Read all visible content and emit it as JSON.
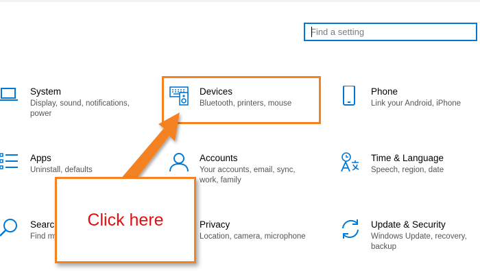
{
  "search": {
    "placeholder": "Find a setting"
  },
  "tiles": [
    {
      "title": "System",
      "desc": "Display, sound, notifications, power",
      "icon": "laptop-icon"
    },
    {
      "title": "Devices",
      "desc": "Bluetooth, printers, mouse",
      "icon": "keyboard-speaker-icon"
    },
    {
      "title": "Phone",
      "desc": "Link your Android, iPhone",
      "icon": "phone-icon"
    },
    {
      "title": "Apps",
      "desc": "Uninstall, defaults",
      "icon": "apps-list-icon"
    },
    {
      "title": "Accounts",
      "desc": "Your accounts, email, sync, work, family",
      "icon": "person-icon"
    },
    {
      "title": "Time & Language",
      "desc": "Speech, region, date",
      "icon": "time-language-icon"
    },
    {
      "title": "Search",
      "desc": "Find my",
      "icon": "search-icon"
    },
    {
      "title": "Privacy",
      "desc": "Location, camera, microphone",
      "icon": "lock-icon"
    },
    {
      "title": "Update & Security",
      "desc": "Windows Update, recovery, backup",
      "icon": "refresh-icon"
    }
  ],
  "annotation": {
    "callout_text": "Click here",
    "accent_color": "#f58220",
    "text_color": "#e01010"
  },
  "colors": {
    "icon_blue": "#0078d7",
    "search_border": "#0078d7"
  }
}
